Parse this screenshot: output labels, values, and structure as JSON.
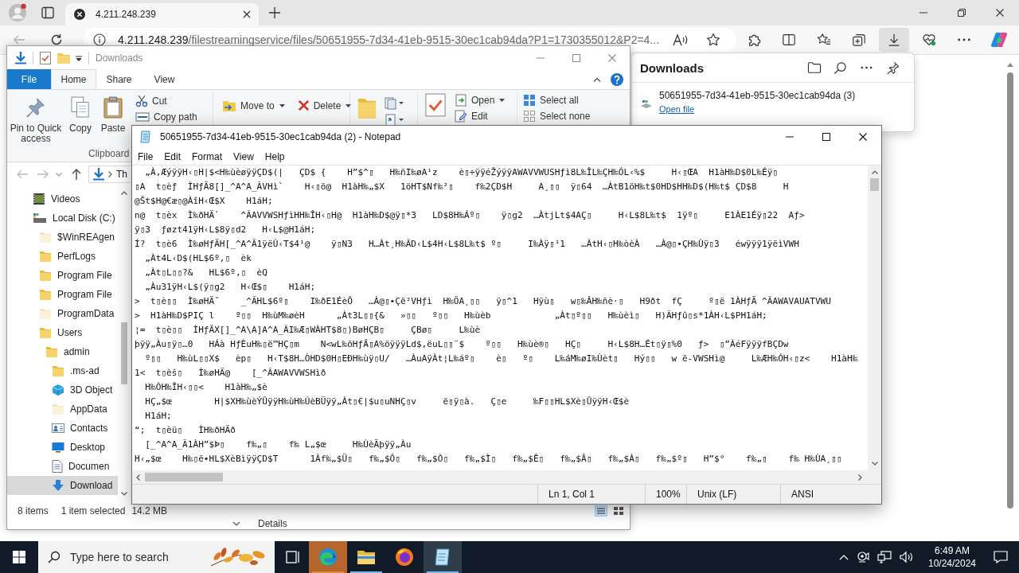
{
  "browser": {
    "tabs": [
      {
        "title": "4.211.248.239",
        "selected": true
      }
    ],
    "url": {
      "host": "4.211.248.239",
      "path": "/filestreamingservice/files/50651955-7d34-41eb-9515-30ec1cab94da?P1=1730355012&P2=4..."
    },
    "downloads_button": {
      "selected": true
    },
    "downloads_panel": {
      "title": "Downloads",
      "items": [
        {
          "name": "50651955-7d34-41eb-9515-30ec1cab94da (3)",
          "link": "Open file"
        }
      ]
    }
  },
  "explorer": {
    "title": "Downloads",
    "file_tab": "File",
    "tabs": [
      {
        "label": "Home",
        "selected": true
      },
      {
        "label": "Share",
        "selected": false
      },
      {
        "label": "View",
        "selected": false
      }
    ],
    "ribbon": {
      "clipboard_large": [
        {
          "kind": "pin",
          "label": "Pin to Quick access"
        },
        {
          "kind": "copy",
          "label": "Copy"
        },
        {
          "kind": "paste",
          "label": "Paste"
        }
      ],
      "clipboard_small": [
        {
          "kind": "cut",
          "label": "Cut"
        },
        {
          "kind": "copy_path",
          "label": "Copy path"
        }
      ],
      "clipboard_label": "Clipboard",
      "organize": [
        {
          "kind": "move",
          "label": "Move to",
          "dropdown": true
        },
        {
          "kind": "delete",
          "label": "Delete",
          "dropdown": true
        }
      ],
      "open": [
        {
          "kind": "open",
          "label": "Open",
          "dropdown": true
        },
        {
          "kind": "edit",
          "label": "Edit",
          "dropdown": false
        }
      ],
      "select": [
        {
          "kind": "select_all",
          "label": "Select all"
        },
        {
          "kind": "select_none",
          "label": "Select none"
        }
      ]
    },
    "address": "Th",
    "nav": [
      {
        "label": "Videos",
        "kind": "videos",
        "selected": false,
        "hidden": false
      },
      {
        "label": "Local Disk (C:)",
        "kind": "drive",
        "selected": false,
        "hidden": false,
        "children": [
          {
            "label": "$WinREAgen",
            "kind": "folder",
            "selected": false,
            "hidden": true
          },
          {
            "label": "PerfLogs",
            "kind": "folder",
            "selected": false,
            "hidden": false
          },
          {
            "label": "Program File",
            "kind": "folder",
            "selected": false,
            "hidden": false
          },
          {
            "label": "Program File",
            "kind": "folder",
            "selected": false,
            "hidden": false
          },
          {
            "label": "ProgramData",
            "kind": "folder",
            "selected": false,
            "hidden": true
          },
          {
            "label": "Users",
            "kind": "folder",
            "selected": false,
            "hidden": false,
            "children": [
              {
                "label": "admin",
                "kind": "folder",
                "selected": false,
                "hidden": false,
                "children": [
                  {
                    "label": ".ms-ad",
                    "kind": "folder",
                    "selected": false,
                    "hidden": false
                  },
                  {
                    "label": "3D Object",
                    "kind": "objects3d",
                    "selected": false,
                    "hidden": false
                  },
                  {
                    "label": "AppData",
                    "kind": "folder",
                    "selected": false,
                    "hidden": true
                  },
                  {
                    "label": "Contacts",
                    "kind": "contacts",
                    "selected": false,
                    "hidden": false
                  },
                  {
                    "label": "Desktop",
                    "kind": "desktop",
                    "selected": false,
                    "hidden": false
                  },
                  {
                    "label": "Documen",
                    "kind": "documents",
                    "selected": false,
                    "hidden": false
                  },
                  {
                    "label": "Download",
                    "kind": "downloads",
                    "selected": true,
                    "hidden": false
                  }
                ]
              }
            ]
          }
        ]
      }
    ],
    "status": {
      "count": "8 items",
      "selection": "1 item selected",
      "size": "14.2 MB"
    },
    "details": "Details"
  },
  "notepad": {
    "title": "50651955-7d34-41eb-9515-30ec1cab94da (2) - Notepad",
    "menu": [
      "File",
      "Edit",
      "Format",
      "View",
      "Help"
    ],
    "lines": [
      "  „À‚ÆýÿÿH‹▯H|$<H‰ùèøÿÿÇD$(|   ÇD$ {    H”$^▯   H‰ñI‰øA¹z    è▯÷ÿÿéŽýÿÿAWAVVWUSHƒì8L‰ÎL‰ÇH‰ÓL‹%$     H‹▯ŒA  H1àH‰D$0L‰Éÿ▯",
      "▯A  t▯èƒ  ÌHƒÄ8[]_^A^A_ÃVHì`    H‹▯ö@  H1àH‰„$X   1öHT$Nf‰²▯    f‰2ÇD$H     A¸▯▯  ÿ▯64  …ÀtB1öH‰t$0HD$HH‰D$(H‰t$ ÇD$8     H",
      "@Št$H@€æ▯@ÀîH‹Œ$X    H1áH;",
      "n@  t▯èx  Ì‰ðHÄ`    ^ÃAVVWSHƒìHH‰ÎH‹▯H@  H1àH‰D$@ÿ▯*3   LD$8H‰Áº▯    ÿ▯g2  …ÀtjLt$4AÇ▯     H‹L$8L‰t$  1ÿº▯     E1ÀE1Éÿ▯22  Aƒ>",
      "ÿ▯3  ƒøzt41ÿH‹L$8ÿ▯d2   H‹L$@H1áH;",
      "Í?  t▯è6  Ì‰øHƒÄH[_^A^Ã1ÿëÙ‹T$4¹@    ÿ▯N3   H…Àt¸H‰ÃD‹L$4H‹L$8L‰t$ º▯     I‰Àÿ▯¹1   …ÀtH‹▯H‰òèÀ   …À@▯•ÇH‰Ùÿ▯3   éwÿÿÿ1ÿëìVWH",
      "  „Àt4L‹D$(HL$6º‚▯  èk",
      "  „Àt▯L▯▯?&   HL$6º‚▯  èQ",
      "  „Àu31ÿH‹L$(ÿ▯g2   H‹Œ$▯    H1áH;",
      ">  t▯è▯▯  Ì‰øHÄ˜    _^ÃHL$6º▯    I‰ðE1ÉèÔ   …À@▯•Çë²VHƒì  H‰ÖA¸▯▯   ÿ▯^1   Hÿù▯   w▯‰ÂH‰ñè·▯   H9ðt  fÇ     º▯ë 1ÀHƒÄ ^ÃAWAVAUATVWU",
      ">  H1àH‰D$PIÇ l    º▯▯  H‰ùM‰øèH      „Àt3L▯▯{&   »▯▯   º▯▯   H‰ùèb            „Àt▯º▯▯   H‰ùèì▯   H)ÃHƒû▯s*1ÀH‹L$PH1áH;",
      "¦=  t▯è▯▯  ÌHƒÄX[]_^A\\A]A^A_ÃI‰Æ▯WÀHT$8▯)BøHÇB▯     ÇBø▯     L‰ùè",
      "þÿÿ„Àu▯ÿ▯…0   HÁà HƒÈuH‰▯ë™HÇ▯m    N<wL‰õHƒÂ▯A%öÿÿÿLd$,ëuL▯▯¨$    º▯▯   H‰ùè®▯   HÇ▯     H‹L$8H…Ét▯ÿ▯%0   ƒ>  ▯”ÀéFÿÿÿfBÇDw",
      "  º▯▯   H‰ùL▯▯X$   èp▯   H‹T$8H…ÒHD$0H▯EÐH‰ùÿ▯U/   …ÀuAÿÀt¦L‰áº▯    è▯   º▯    L‰áM‰øI‰Ùèt▯   Hý▯▯   w ë-VWSHì@     L‰ÆH‰ÓH‹▯z<    H1àH‰",
      "1<  t▯èš▯   Ì‰øHÄ@    [_^ÃAWAVVWSHìð",
      "  H‰ÓH‰ÎH‹▯▯<    H1àH‰„$è",
      "  HÇ„$œ        H|$XH‰ùèÝÛÿÿH‰ùH‰ÚèBÜÿÿ„Àt▯€|$u▯uNHÇ▯v     ë▯ÿ▯à.   Ç▯e     ‰F▯▯HL$Xè▯ÛÿÿH‹Œ$è",
      "  H1áH;",
      "“;  t▯èü▯   ÌH‰ðHÄð",
      "  [_^A^A_Ã1ÀH”$Þ▯    f‰„▯    f‰ L„$œ     H‰ÙèÄþÿÿ„Àu",
      "H‹„$œ    H‰▯ë•HL$XèBìÿÿÇD$T      1Àf‰„$Ü▯   f‰„$Ô▯   f‰„$Ò▯   f‰„$Ì▯   f‰„$Ê▯   f‰„$Â▯   f‰„$À▯   f‰„$º▯   H”$°    f‰„▯    f‰ H‰ÙA¸▯▯"
    ],
    "status": {
      "position": "Ln 1, Col 1",
      "zoom": "100%",
      "line_ending": "Unix (LF)",
      "encoding": "ANSI"
    }
  },
  "taskbar": {
    "search": {
      "placeholder": "Type here to search"
    },
    "apps": [
      {
        "kind": "edge",
        "running": true,
        "active": false,
        "flashing": true
      },
      {
        "kind": "explorer",
        "running": true,
        "active": false,
        "flashing": false
      },
      {
        "kind": "firefox",
        "running": false,
        "active": false,
        "flashing": false
      },
      {
        "kind": "notepad",
        "running": true,
        "active": true,
        "flashing": false
      }
    ],
    "clock": {
      "time": "6:49 AM",
      "date": "10/24/2024"
    }
  }
}
